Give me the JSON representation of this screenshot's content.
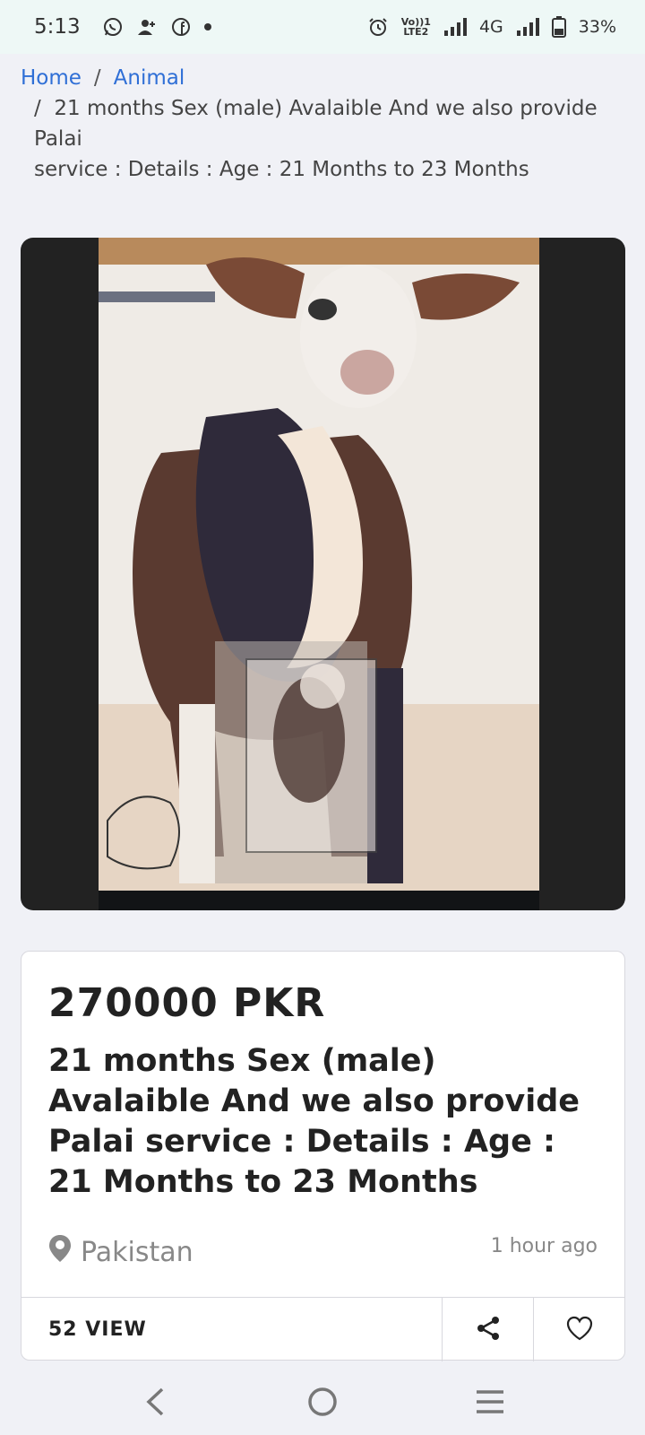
{
  "status_bar": {
    "time": "5:13",
    "network_label": "4G",
    "volte_label": "Vo)) 1\nLTE2",
    "battery": "33%",
    "icons": [
      "whatsapp-icon",
      "contacts-icon",
      "facebook-icon",
      "dot-icon",
      "alarm-icon",
      "signal-icon",
      "battery-icon"
    ]
  },
  "breadcrumb": {
    "home": "Home",
    "separator": "/",
    "category": "Animal",
    "current": "21 months Sex (male) Avalaible And we also provide Palai",
    "current_line2": "service : Details : Age : 21 Months to 23 Months"
  },
  "listing": {
    "price": "270000 PKR",
    "title": "21 months Sex (male) Avalaible And we also provide Palai service : Details : Age : 21 Months to 23 Months",
    "location": "Pakistan",
    "posted": "1 hour ago",
    "views": "52 VIEW"
  },
  "colors": {
    "accent_link": "#2f6fd6",
    "status_bar_bg": "#eef8f6",
    "page_bg": "#f0f1f6",
    "viewer_bg": "#222222"
  }
}
